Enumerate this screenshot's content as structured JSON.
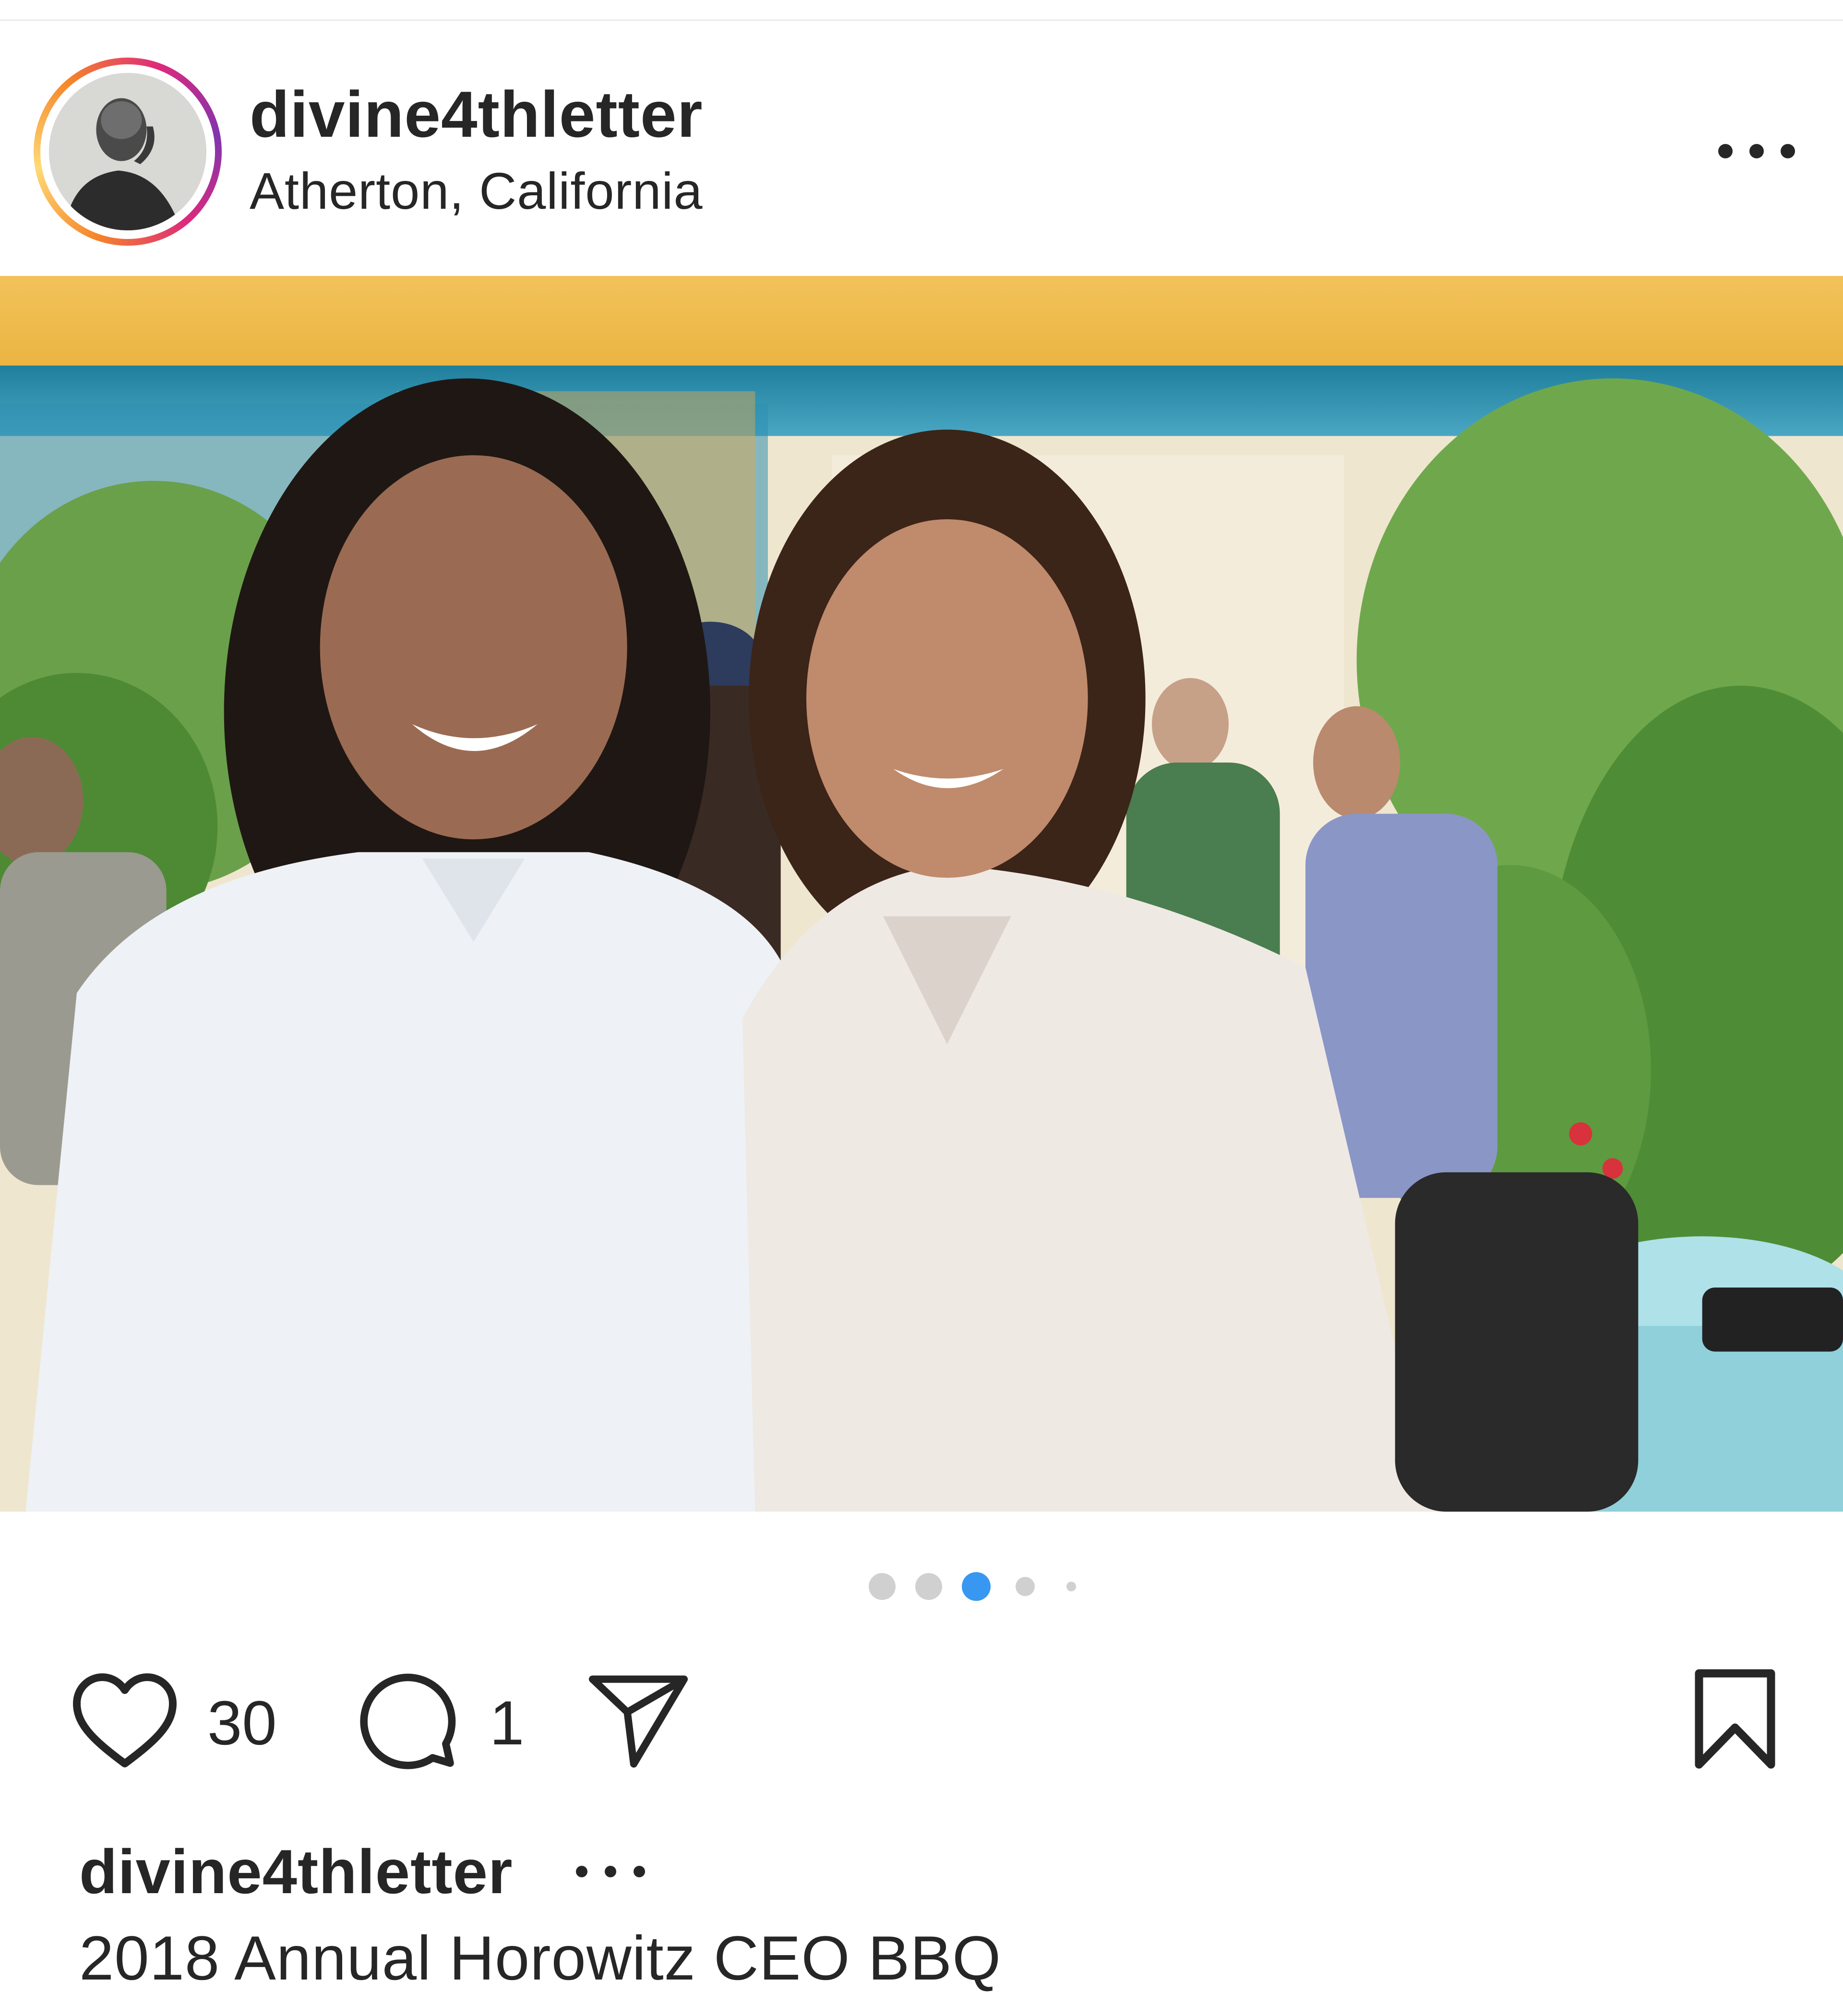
{
  "post": {
    "username": "divine4thletter",
    "location": "Atherton, California",
    "likes": "30",
    "comments": "1",
    "caption_user": "divine4thletter",
    "caption_text": "2018 Annual Horowitz CEO BBQ"
  },
  "carousel": {
    "total": 5,
    "active_index": 2
  },
  "icons": {
    "more": "more-horizontal-icon",
    "like": "heart-icon",
    "comment": "comment-bubble-icon",
    "share": "paper-plane-icon",
    "save": "bookmark-icon"
  },
  "colors": {
    "active_dot": "#3897f0",
    "inactive_dot": "#d0d0d0",
    "text": "#262626"
  }
}
